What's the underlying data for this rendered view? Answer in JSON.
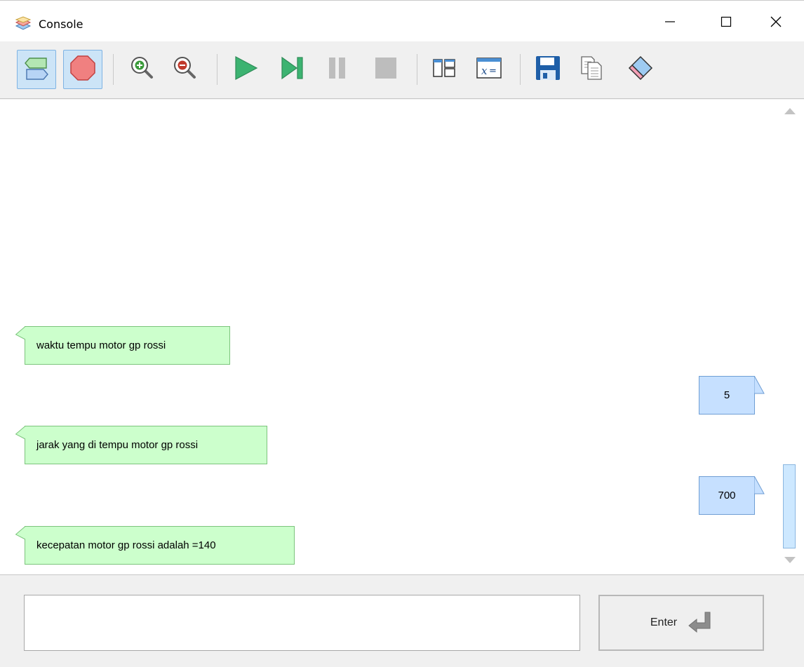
{
  "window": {
    "title": "Console",
    "icon": "console-layers-icon"
  },
  "window_controls": {
    "minimize_icon": "minimize-icon",
    "maximize_icon": "maximize-icon",
    "close_icon": "close-icon"
  },
  "toolbar": {
    "buttons": [
      {
        "name": "toggle-io-view-button",
        "icon": "io-shapes-icon",
        "active": true
      },
      {
        "name": "stop-sign-button",
        "icon": "stop-octagon-icon",
        "active": true
      },
      {
        "name": "zoom-in-button",
        "icon": "zoom-in-icon",
        "active": false
      },
      {
        "name": "zoom-out-button",
        "icon": "zoom-out-icon",
        "active": false
      },
      {
        "name": "run-button",
        "icon": "play-icon",
        "active": false
      },
      {
        "name": "step-button",
        "icon": "step-icon",
        "active": false
      },
      {
        "name": "pause-button",
        "icon": "pause-icon",
        "active": false
      },
      {
        "name": "stop-button",
        "icon": "stop-icon",
        "active": false
      },
      {
        "name": "layout-button",
        "icon": "layout-panels-icon",
        "active": false
      },
      {
        "name": "variables-button",
        "icon": "variables-x-icon",
        "active": false
      },
      {
        "name": "save-button",
        "icon": "floppy-disk-icon",
        "active": false
      },
      {
        "name": "copy-button",
        "icon": "copy-icon",
        "active": false
      },
      {
        "name": "clear-button",
        "icon": "eraser-icon",
        "active": false
      }
    ]
  },
  "colors": {
    "output_bubble": "#ccffcc",
    "output_border": "#7cc47c",
    "input_bubble": "#c6e0ff",
    "input_border": "#6f9ed4",
    "active_tool": "#cce4f7"
  },
  "console": {
    "messages": [
      {
        "kind": "output",
        "text": "waktu tempu motor gp rossi"
      },
      {
        "kind": "input",
        "text": "5"
      },
      {
        "kind": "output",
        "text": "jarak yang di tempu motor gp rossi"
      },
      {
        "kind": "input",
        "text": "700"
      },
      {
        "kind": "output",
        "text": "kecepatan motor gp rossi adalah =140"
      }
    ]
  },
  "input": {
    "value": "",
    "placeholder": ""
  },
  "enter_button": {
    "label": "Enter",
    "icon": "enter-return-icon"
  }
}
